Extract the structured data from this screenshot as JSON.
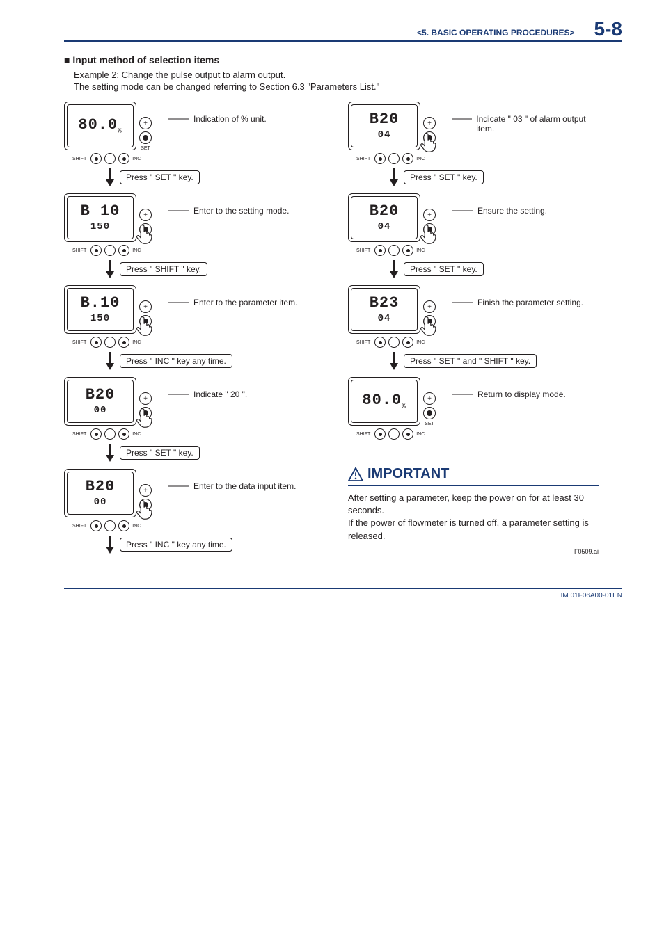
{
  "header": {
    "chapter": "<5.  BASIC OPERATING PROCEDURES>",
    "page": "5-8"
  },
  "section": {
    "title": "Input method of selection items",
    "example": "Example 2: Change the pulse output to alarm output.",
    "note": "The setting mode can be changed referring to Section 6.3 \"Parameters List.\""
  },
  "left": [
    {
      "big": "80.0",
      "unit": "%",
      "small": "",
      "desc": "Indication of % unit.",
      "action": "Press \" SET \" key."
    },
    {
      "big": "B 10",
      "unit": "",
      "small": "150",
      "desc": "Enter to the setting mode.",
      "action": "Press \" SHIFT \" key."
    },
    {
      "big": "B.10",
      "unit": "",
      "small": "150",
      "desc": "Enter to the parameter item.",
      "action": "Press \" INC \" key any time."
    },
    {
      "big": "B20",
      "unit": "",
      "small": "00",
      "desc": "Indicate \" 20 \".",
      "action": "Press \" SET \" key."
    },
    {
      "big": "B20",
      "unit": "",
      "small": "00",
      "desc": "Enter to the data input item.",
      "action": "Press \" INC \" key any time."
    }
  ],
  "right": [
    {
      "big": "B20",
      "unit": "",
      "small": "04",
      "desc": "Indicate \" 03 \" of alarm output item.",
      "action": "Press \" SET \" key."
    },
    {
      "big": "B20",
      "unit": "",
      "small": "04",
      "desc": "Ensure the setting.",
      "action": "Press \" SET \" key."
    },
    {
      "big": "B23",
      "unit": "",
      "small": "04",
      "desc": "Finish the parameter setting.",
      "action": "Press \" SET \" and \" SHIFT \" key."
    },
    {
      "big": "80.0",
      "unit": "%",
      "small": "",
      "desc": "Return to display mode.",
      "action": ""
    }
  ],
  "labels": {
    "set": "SET",
    "shift": "SHIFT",
    "inc": "INC"
  },
  "important": {
    "title": "IMPORTANT",
    "body1": "After setting a parameter, keep the power on for at least 30 seconds.",
    "body2": "If the power of flowmeter is turned off, a parameter setting is released."
  },
  "figref": "F0509.ai",
  "footer": "IM 01F06A00-01EN"
}
